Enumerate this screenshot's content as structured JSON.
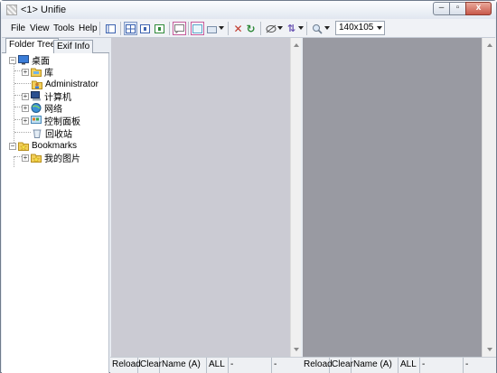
{
  "window": {
    "title": "<1> Unifie",
    "min_glyph": "–",
    "max_glyph": "▫",
    "close_glyph": "x"
  },
  "menu": {
    "file": "File",
    "view": "View",
    "tools": "Tools",
    "help": "Help"
  },
  "toolbar": {
    "zoom_value": "140x105",
    "icons": [
      "single-pane-icon",
      "grid-layout-icon",
      "page-one-icon",
      "page-two-icon",
      "comment-icon",
      "frame-icon",
      "slide-icon",
      "delete-icon",
      "refresh-icon",
      "rotate-icon",
      "sort-icon",
      "search-icon"
    ],
    "accent": "#7f98c4"
  },
  "tabs": {
    "folder_tree": "Folder Tree",
    "exif_info": "Exif Info"
  },
  "tree": {
    "desktop": "桌面",
    "library": "库",
    "administrator": "Administrator",
    "computer": "计算机",
    "network": "网络",
    "control_panel": "控制面板",
    "recycle_bin": "回收站",
    "bookmarks": "Bookmarks",
    "my_pictures": "我的图片"
  },
  "status_left": {
    "reload": "Reload",
    "clear": "Clear",
    "sort": "Name (A)",
    "filter": "ALL",
    "field1": "-",
    "field2": "-"
  },
  "status_right": {
    "reload": "Reload",
    "clear": "Clear",
    "sort": "Name (A)",
    "filter": "ALL",
    "field1": "-",
    "field2": "-"
  },
  "colors": {
    "pane_left": "#cbcbd3",
    "pane_right": "#999aa2",
    "close_button": "#c8584a"
  }
}
